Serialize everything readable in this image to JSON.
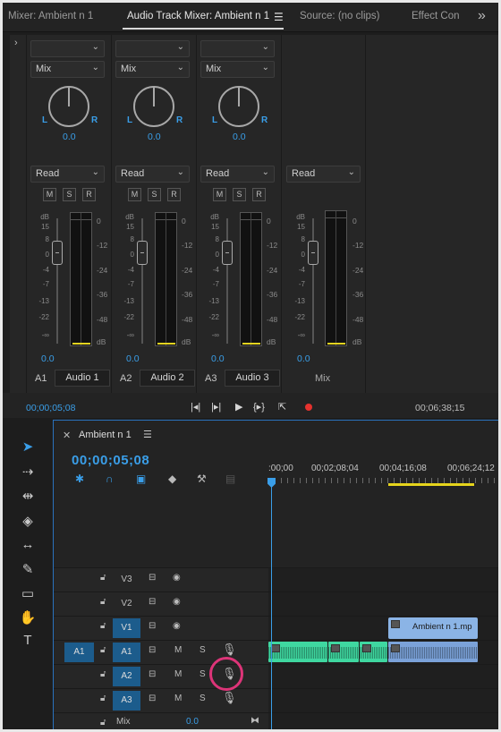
{
  "tabs": [
    {
      "label": "Mixer: Ambient n 1"
    },
    {
      "label": "Audio Track Mixer: Ambient n 1"
    },
    {
      "label": "Source: (no clips)"
    },
    {
      "label": "Effect Con"
    }
  ],
  "mixer": {
    "channels": [
      {
        "assign": "A1",
        "name": "Audio 1",
        "mode": "Mix",
        "pan": "0.0",
        "automation": "Read",
        "volume": "0.0"
      },
      {
        "assign": "A2",
        "name": "Audio 2",
        "mode": "Mix",
        "pan": "0.0",
        "automation": "Read",
        "volume": "0.0"
      },
      {
        "assign": "A3",
        "name": "Audio 3",
        "mode": "Mix",
        "pan": "0.0",
        "automation": "Read",
        "volume": "0.0"
      }
    ],
    "master": {
      "name": "Mix",
      "automation": "Read",
      "volume": "0.0"
    },
    "labels": {
      "L": "L",
      "R": "R",
      "M": "M",
      "S": "S",
      "Rb": "R",
      "db": "dB"
    },
    "fader_scale": [
      "15",
      "8",
      "0",
      "-4",
      "-7",
      "-13",
      "-22",
      "-∞"
    ],
    "meter_scale": [
      "0",
      "-12",
      "-24",
      "-36",
      "-48",
      "dB"
    ],
    "transport": {
      "current": "00;00;05;08",
      "duration": "00;06;38;15"
    }
  },
  "timeline": {
    "sequence_name": "Ambient n 1",
    "timecode": "00;00;05;08",
    "ruler": [
      ":00;00",
      "00;02;08;04",
      "00;04;16;08",
      "00;06;24;12"
    ],
    "tracks": [
      {
        "name": "V3",
        "type": "video"
      },
      {
        "name": "V2",
        "type": "video"
      },
      {
        "name": "V1",
        "type": "video",
        "patched": true
      },
      {
        "name": "A1",
        "type": "audio",
        "patched": true,
        "source": "A1",
        "m": "M",
        "s": "S"
      },
      {
        "name": "A2",
        "type": "audio",
        "patched": true,
        "m": "M",
        "s": "S"
      },
      {
        "name": "A3",
        "type": "audio",
        "patched": true,
        "m": "M",
        "s": "S"
      }
    ],
    "mix": {
      "label": "Mix",
      "value": "0.0"
    },
    "clip_name": "Ambient n 1.mp"
  },
  "colors": {
    "accent_blue": "#3a9ee8",
    "audio_clip_green": "#3fd7a0",
    "audio_clip_blue": "#7ba2d9",
    "video_clip": "#8bb4e6",
    "record_red": "#e5322e",
    "highlight": "#dd3478",
    "meter_yellow": "#e3d320"
  }
}
